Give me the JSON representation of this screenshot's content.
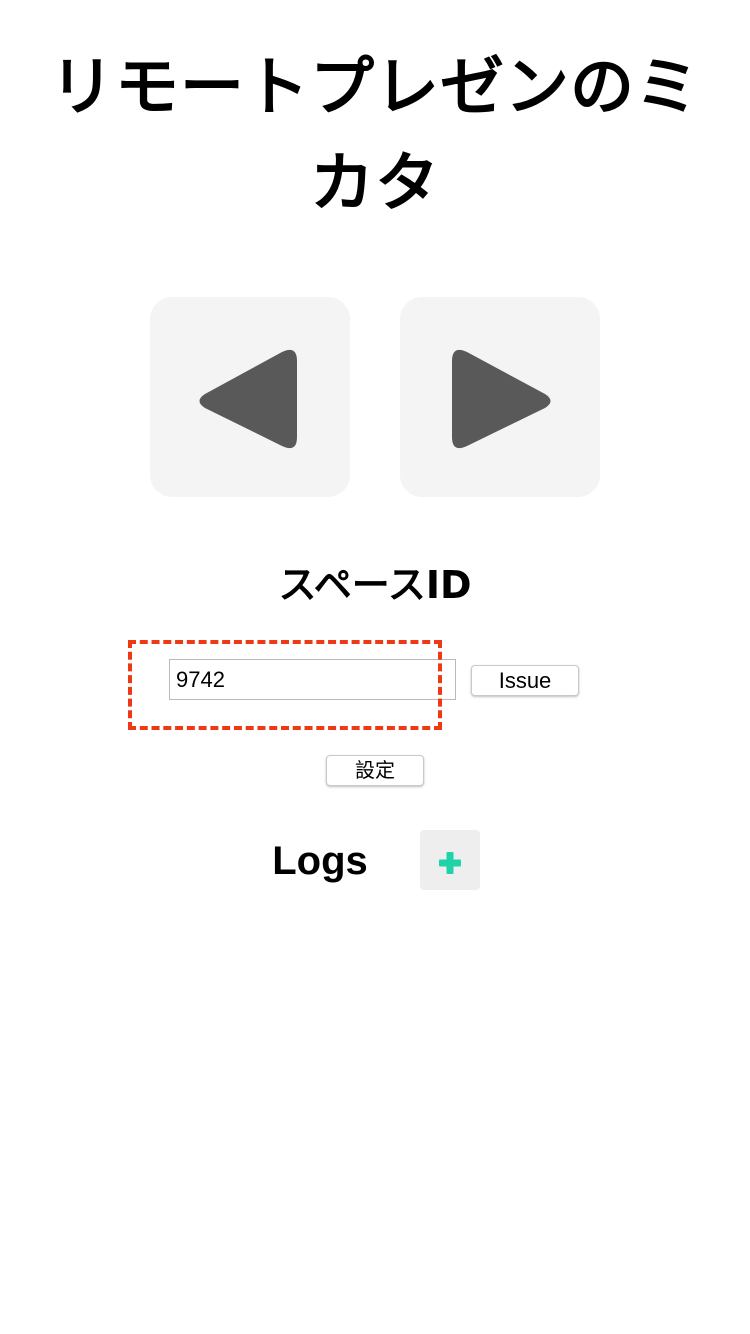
{
  "app": {
    "title": "リモートプレゼンのミカタ"
  },
  "controls": {
    "prev_icon": "triangle-left-icon",
    "next_icon": "triangle-right-icon",
    "icon_color": "#595959"
  },
  "space": {
    "heading": "スペースID",
    "input_value": "9742",
    "issue_label": "Issue",
    "set_label": "設定",
    "highlight_color": "#ee3a14"
  },
  "logs": {
    "heading": "Logs",
    "add_icon": "plus-icon",
    "add_color": "#1fd3a9"
  }
}
